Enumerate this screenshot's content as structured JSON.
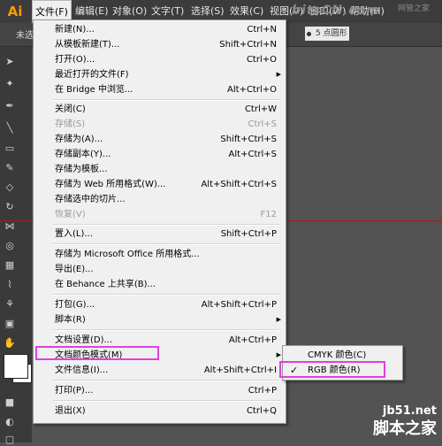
{
  "app": {
    "logo": "Ai"
  },
  "menubar": {
    "items": [
      "文件(F)",
      "编辑(E)",
      "对象(O)",
      "文字(T)",
      "选择(S)",
      "效果(C)",
      "视图(V)",
      "窗口(W)",
      "帮助(H)"
    ]
  },
  "controlbar": {
    "status": "未选",
    "stroke_value": "5 点圆形"
  },
  "watermark": {
    "top": "bitsCN.com",
    "top_sub": "网管之家",
    "bottom_url": "jb51.net",
    "bottom_name": "脚本之家"
  },
  "file_menu": {
    "items": [
      {
        "label": "新建(N)...",
        "shortcut": "Ctrl+N"
      },
      {
        "label": "从模板新建(T)...",
        "shortcut": "Shift+Ctrl+N"
      },
      {
        "label": "打开(O)...",
        "shortcut": "Ctrl+O"
      },
      {
        "label": "最近打开的文件(F)",
        "shortcut": ""
      },
      {
        "label": "在 Bridge 中浏览...",
        "shortcut": "Alt+Ctrl+O"
      },
      {
        "label": "关闭(C)",
        "shortcut": "Ctrl+W"
      },
      {
        "label": "存储(S)",
        "shortcut": "Ctrl+S"
      },
      {
        "label": "存储为(A)...",
        "shortcut": "Shift+Ctrl+S"
      },
      {
        "label": "存储副本(Y)...",
        "shortcut": "Alt+Ctrl+S"
      },
      {
        "label": "存储为模板...",
        "shortcut": ""
      },
      {
        "label": "存储为 Web 所用格式(W)...",
        "shortcut": "Alt+Shift+Ctrl+S"
      },
      {
        "label": "存储选中的切片...",
        "shortcut": ""
      },
      {
        "label": "恢复(V)",
        "shortcut": "F12"
      },
      {
        "label": "置入(L)...",
        "shortcut": "Shift+Ctrl+P"
      },
      {
        "label": "存储为 Microsoft Office 所用格式...",
        "shortcut": ""
      },
      {
        "label": "导出(E)...",
        "shortcut": ""
      },
      {
        "label": "在 Behance 上共享(B)...",
        "shortcut": ""
      },
      {
        "label": "打包(G)...",
        "shortcut": "Alt+Shift+Ctrl+P"
      },
      {
        "label": "脚本(R)",
        "shortcut": ""
      },
      {
        "label": "文档设置(D)...",
        "shortcut": "Alt+Ctrl+P"
      },
      {
        "label": "文档颜色模式(M)",
        "shortcut": ""
      },
      {
        "label": "文件信息(I)...",
        "shortcut": "Alt+Shift+Ctrl+I"
      },
      {
        "label": "打印(P)...",
        "shortcut": "Ctrl+P"
      },
      {
        "label": "退出(X)",
        "shortcut": "Ctrl+Q"
      }
    ]
  },
  "color_mode_submenu": {
    "items": [
      {
        "label": "CMYK 颜色(C)",
        "checked": false
      },
      {
        "label": "RGB 颜色(R)",
        "checked": true
      }
    ],
    "check_mark": "✓"
  },
  "colors": {
    "highlight": "#e040e0",
    "menu_bg": "#f0f0f0",
    "app_bg": "#535353"
  }
}
